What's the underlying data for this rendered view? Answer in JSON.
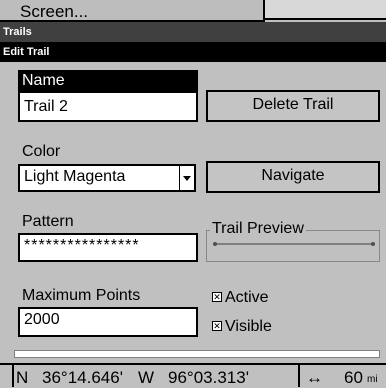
{
  "menu": {
    "screen_tab": "Screen..."
  },
  "bars": {
    "trails": "Trails",
    "edit_trail": "Edit Trail"
  },
  "form": {
    "name_label": "Name",
    "name_value": "Trail 2",
    "delete_button": "Delete Trail",
    "color_label": "Color",
    "color_value": "Light Magenta",
    "navigate_button": "Navigate",
    "pattern_label": "Pattern",
    "pattern_value": "****************",
    "trail_preview_label": "Trail Preview",
    "max_points_label": "Maximum Points",
    "max_points_value": "2000",
    "active_label": "Active",
    "active_checked": true,
    "visible_label": "Visible",
    "visible_checked": true
  },
  "status": {
    "lat_hemi": "N",
    "lat": "36°14.646'",
    "lon_hemi": "W",
    "lon": "96°03.313'",
    "distance_icon": "double-arrow-icon",
    "distance": "60",
    "distance_unit": "mi"
  }
}
